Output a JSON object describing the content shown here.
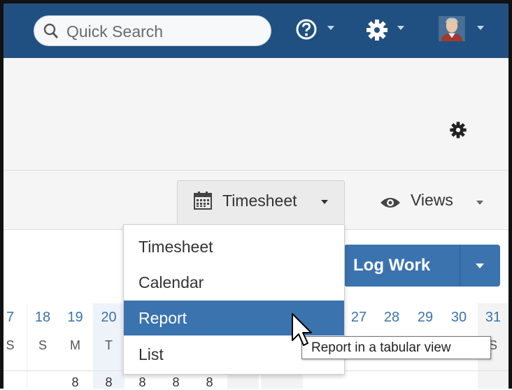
{
  "topbar": {
    "search_placeholder": "Quick Search",
    "icons": [
      "search-icon",
      "help-icon",
      "gear-icon",
      "avatar",
      "chevron-down-icon"
    ]
  },
  "toolbar": {
    "timesheet_label": "Timesheet",
    "views_label": "Views"
  },
  "actions": {
    "log_work_label": "Log Work"
  },
  "menu": {
    "items": [
      {
        "label": "Timesheet"
      },
      {
        "label": "Calendar"
      },
      {
        "label": "Report"
      },
      {
        "label": "List"
      }
    ],
    "active_index": 2
  },
  "tooltip": "Report in a tabular view",
  "calendar": {
    "days": [
      {
        "date": "7",
        "weekday": "S",
        "hours": ""
      },
      {
        "date": "18",
        "weekday": "S",
        "hours": ""
      },
      {
        "date": "19",
        "weekday": "M",
        "hours": "8"
      },
      {
        "date": "20",
        "weekday": "T",
        "hours": "8"
      },
      {
        "date": "",
        "weekday": "",
        "hours": "8"
      },
      {
        "date": "",
        "weekday": "",
        "hours": "8"
      },
      {
        "date": "",
        "weekday": "",
        "hours": "8"
      },
      {
        "date": "",
        "weekday": "",
        "hours": ""
      },
      {
        "date": "",
        "weekday": "",
        "hours": ""
      },
      {
        "date": "27",
        "weekday": "",
        "hours": ""
      },
      {
        "date": "28",
        "weekday": "",
        "hours": ""
      },
      {
        "date": "29",
        "weekday": "",
        "hours": ""
      },
      {
        "date": "30",
        "weekday": "",
        "hours": ""
      },
      {
        "date": "31",
        "weekday": "S",
        "hours": ""
      }
    ]
  },
  "colors": {
    "topbar": "#205081",
    "primary": "#3b73af",
    "menu_active": "#3b73af"
  }
}
